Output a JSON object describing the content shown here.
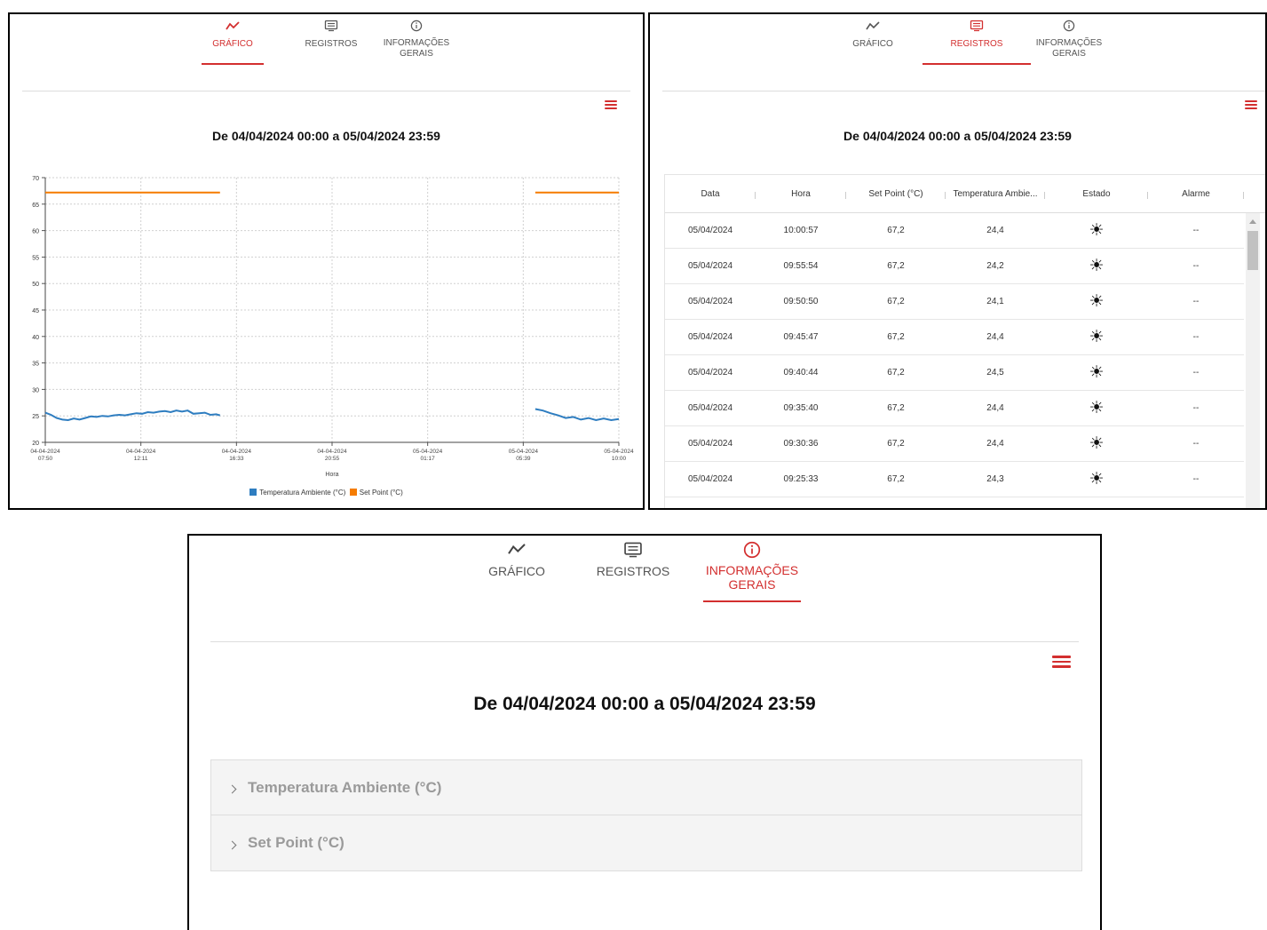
{
  "tabs": {
    "grafico": "GRÁFICO",
    "registros": "REGISTROS",
    "info_line1": "INFORMAÇÕES",
    "info_line2": "GERAIS"
  },
  "range_title": "De 04/04/2024 00:00 a 05/04/2024 23:59",
  "colors": {
    "accent": "#d32f2f",
    "series_temp": "#2e7dc0",
    "series_setpoint": "#f57c00"
  },
  "chart_data": {
    "type": "line",
    "xlabel": "Hora",
    "ylim": [
      20,
      70
    ],
    "yticks": [
      "70",
      "65",
      "60",
      "55",
      "50",
      "45",
      "40",
      "35",
      "30",
      "25",
      "20"
    ],
    "xticks": [
      {
        "date": "04-04-2024",
        "time": "07:50"
      },
      {
        "date": "04-04-2024",
        "time": "12:11"
      },
      {
        "date": "04-04-2024",
        "time": "16:33"
      },
      {
        "date": "04-04-2024",
        "time": "20:55"
      },
      {
        "date": "05-04-2024",
        "time": "01:17"
      },
      {
        "date": "05-04-2024",
        "time": "05:39"
      },
      {
        "date": "05-04-2024",
        "time": "10:00"
      }
    ],
    "grid": true,
    "legend_position": "bottom",
    "series": [
      {
        "name": "Temperatura Ambiente (°C)",
        "segments": [
          [
            [
              0,
              25.6
            ],
            [
              0.3,
              25.2
            ],
            [
              0.6,
              24.6
            ],
            [
              0.9,
              24.3
            ],
            [
              1.2,
              24.2
            ],
            [
              1.5,
              24.5
            ],
            [
              1.8,
              24.3
            ],
            [
              2.1,
              24.6
            ],
            [
              2.4,
              24.9
            ],
            [
              2.7,
              24.8
            ],
            [
              3.0,
              25.0
            ],
            [
              3.3,
              24.9
            ],
            [
              3.6,
              25.1
            ],
            [
              3.9,
              25.2
            ],
            [
              4.2,
              25.1
            ],
            [
              4.5,
              25.3
            ],
            [
              4.8,
              25.5
            ],
            [
              5.1,
              25.4
            ],
            [
              5.4,
              25.7
            ],
            [
              5.7,
              25.6
            ],
            [
              6.0,
              25.8
            ],
            [
              6.3,
              25.9
            ],
            [
              6.6,
              25.7
            ],
            [
              6.9,
              26.0
            ],
            [
              7.2,
              25.8
            ],
            [
              7.5,
              26.0
            ],
            [
              7.8,
              25.4
            ],
            [
              8.1,
              25.5
            ],
            [
              8.4,
              25.6
            ],
            [
              8.7,
              25.2
            ],
            [
              9.0,
              25.3
            ],
            [
              9.2,
              25.1
            ]
          ],
          [
            [
              25.8,
              26.3
            ],
            [
              26.2,
              26.0
            ],
            [
              26.6,
              25.5
            ],
            [
              27.0,
              25.1
            ],
            [
              27.4,
              24.6
            ],
            [
              27.8,
              24.8
            ],
            [
              28.2,
              24.3
            ],
            [
              28.6,
              24.6
            ],
            [
              29.0,
              24.2
            ],
            [
              29.4,
              24.5
            ],
            [
              29.8,
              24.2
            ],
            [
              30.2,
              24.4
            ]
          ]
        ]
      },
      {
        "name": "Set Point (°C)",
        "segments": [
          [
            [
              0,
              67.2
            ],
            [
              9.2,
              67.2
            ]
          ],
          [
            [
              25.8,
              67.2
            ],
            [
              30.2,
              67.2
            ]
          ]
        ]
      }
    ]
  },
  "table": {
    "headers": [
      "Data",
      "Hora",
      "Set Point (°C)",
      "Temperatura Ambie...",
      "Estado",
      "Alarme"
    ],
    "rows": [
      [
        "05/04/2024",
        "10:00:57",
        "67,2",
        "24,4",
        "--"
      ],
      [
        "05/04/2024",
        "09:55:54",
        "67,2",
        "24,2",
        "--"
      ],
      [
        "05/04/2024",
        "09:50:50",
        "67,2",
        "24,1",
        "--"
      ],
      [
        "05/04/2024",
        "09:45:47",
        "67,2",
        "24,4",
        "--"
      ],
      [
        "05/04/2024",
        "09:40:44",
        "67,2",
        "24,5",
        "--"
      ],
      [
        "05/04/2024",
        "09:35:40",
        "67,2",
        "24,4",
        "--"
      ],
      [
        "05/04/2024",
        "09:30:36",
        "67,2",
        "24,4",
        "--"
      ],
      [
        "05/04/2024",
        "09:25:33",
        "67,2",
        "24,3",
        "--"
      ]
    ],
    "estado_icon": "sun-icon",
    "estado_glyph": "☀"
  },
  "accordion": {
    "items": [
      "Temperatura Ambiente (°C)",
      "Set Point (°C)"
    ]
  }
}
